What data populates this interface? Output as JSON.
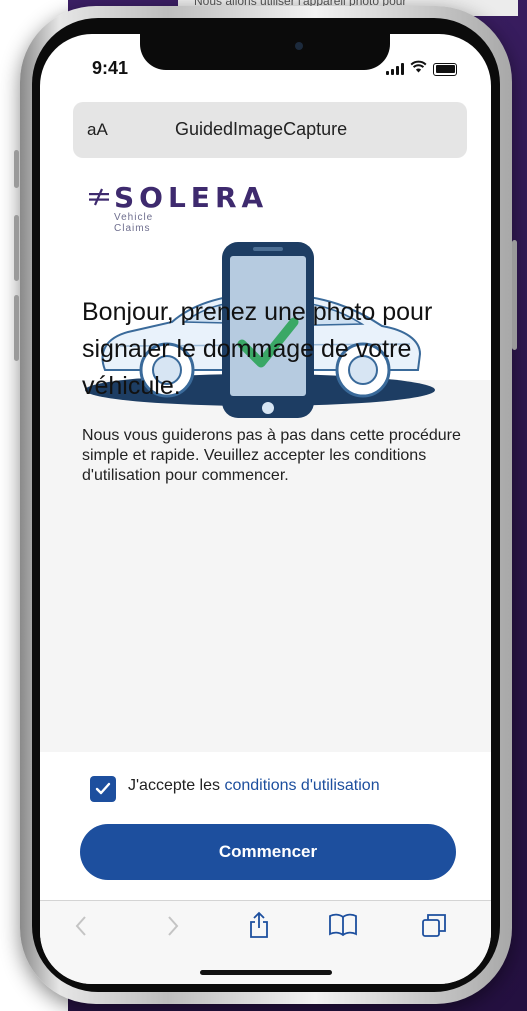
{
  "backdrop": {
    "partial_text": "Nous allons utiliser l'appareil photo pour"
  },
  "status_bar": {
    "time": "9:41"
  },
  "browser": {
    "text_size_label": "aA",
    "url_title": "GuidedImageCapture"
  },
  "brand": {
    "name": "SOLERA",
    "tagline": "Vehicle Claims",
    "color": "#3e2a6e"
  },
  "hero": {
    "illustration": "car-with-phone-checkmark-illustration"
  },
  "main": {
    "headline": "Bonjour, prenez une photo pour signaler le dommage de votre véhicule.",
    "description": "Nous vous guiderons pas à pas dans cette procédure simple et rapide. Veuillez accepter les conditions d'utilisation pour commencer."
  },
  "terms": {
    "checked": true,
    "label_prefix": "J'accepte les ",
    "link_text": "conditions d'utilisation"
  },
  "cta": {
    "label": "Commencer"
  },
  "colors": {
    "primary": "#1d4f9e",
    "accent_check": "#3aa866",
    "backdrop": "#2b1548"
  },
  "toolbar": {
    "items": [
      "back-icon",
      "forward-icon",
      "share-icon",
      "bookmarks-icon",
      "tabs-icon"
    ]
  }
}
